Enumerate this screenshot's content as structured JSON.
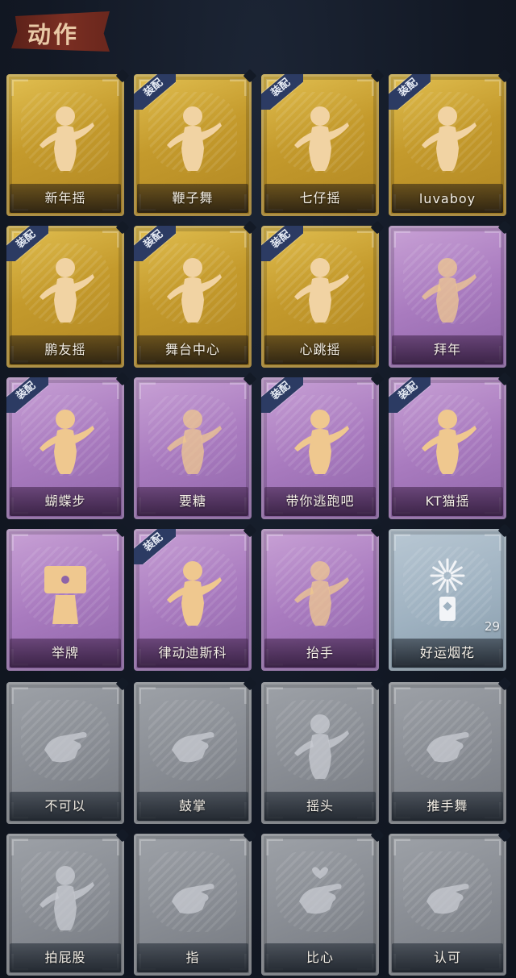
{
  "header": {
    "title": "动作"
  },
  "equipped_tag": "装配",
  "cards": [
    {
      "label": "新年摇",
      "rarity": "gold",
      "equipped": false,
      "icon": "dancer-icon"
    },
    {
      "label": "鞭子舞",
      "rarity": "gold",
      "equipped": true,
      "icon": "dancer-icon"
    },
    {
      "label": "七仔摇",
      "rarity": "gold",
      "equipped": true,
      "icon": "dancer-icon"
    },
    {
      "label": "luvaboy",
      "rarity": "gold",
      "equipped": true,
      "icon": "dancer-icon"
    },
    {
      "label": "鹏友摇",
      "rarity": "gold",
      "equipped": true,
      "icon": "dancer-icon"
    },
    {
      "label": "舞台中心",
      "rarity": "gold",
      "equipped": true,
      "icon": "dancer-icon"
    },
    {
      "label": "心跳摇",
      "rarity": "gold",
      "equipped": true,
      "icon": "dancer-icon"
    },
    {
      "label": "拜年",
      "rarity": "purple",
      "equipped": false,
      "icon": "bowing-figure-icon"
    },
    {
      "label": "蝴蝶步",
      "rarity": "purple",
      "equipped": true,
      "icon": "pointing-figure-icon"
    },
    {
      "label": "要糖",
      "rarity": "purple",
      "equipped": false,
      "icon": "reaching-figure-icon"
    },
    {
      "label": "带你逃跑吧",
      "rarity": "purple",
      "equipped": true,
      "icon": "pointing-figure-icon"
    },
    {
      "label": "KT猫摇",
      "rarity": "purple",
      "equipped": true,
      "icon": "dancer-icon"
    },
    {
      "label": "举牌",
      "rarity": "purple",
      "equipped": false,
      "icon": "sign-holder-icon"
    },
    {
      "label": "律动迪斯科",
      "rarity": "purple",
      "equipped": true,
      "icon": "disco-figure-icon"
    },
    {
      "label": "抬手",
      "rarity": "purple",
      "equipped": false,
      "icon": "raised-hand-icon"
    },
    {
      "label": "好运烟花",
      "rarity": "silver",
      "equipped": false,
      "icon": "firework-icon",
      "count": "29"
    },
    {
      "label": "不可以",
      "rarity": "grey",
      "equipped": false,
      "icon": "finger-wag-icon"
    },
    {
      "label": "鼓掌",
      "rarity": "grey",
      "equipped": false,
      "icon": "clapping-hands-icon"
    },
    {
      "label": "摇头",
      "rarity": "grey",
      "equipped": false,
      "icon": "head-shake-icon"
    },
    {
      "label": "推手舞",
      "rarity": "grey",
      "equipped": false,
      "icon": "push-hands-icon"
    },
    {
      "label": "拍屁股",
      "rarity": "grey",
      "equipped": false,
      "icon": "butt-slap-icon"
    },
    {
      "label": "指",
      "rarity": "grey",
      "equipped": false,
      "icon": "point-icon"
    },
    {
      "label": "比心",
      "rarity": "grey",
      "equipped": false,
      "icon": "finger-heart-icon"
    },
    {
      "label": "认可",
      "rarity": "grey",
      "equipped": false,
      "icon": "thumbs-up-icon"
    }
  ],
  "colors": {
    "gold": "#c49a2c",
    "purple": "#a97bbf",
    "silver": "#9eb1c0",
    "grey": "#878b92",
    "equipped_ribbon": "#2c3b63",
    "title_banner": "#7a2e22"
  }
}
